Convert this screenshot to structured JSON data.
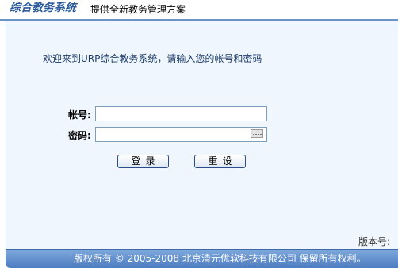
{
  "header": {
    "logo_text": "综合教务系统",
    "tagline": "提供全新教务管理方案"
  },
  "login": {
    "welcome": "欢迎来到URP综合教务系统，请输入您的帐号和密码",
    "account_label": "帐号:",
    "account_value": "",
    "password_label": "密码:",
    "password_value": "",
    "login_button": "登录",
    "reset_button": "重设",
    "keyboard_icon": "virtual-keyboard-icon"
  },
  "version_label": "版本号:",
  "footer": {
    "copyright": "版权所有 © 2005-2008 北京清元优软科技有限公司 保留所有权利。"
  },
  "colors": {
    "header_bar": "#6a94c8",
    "main_bg": "#f0f6fd",
    "footer_bg": "#4d7cc0",
    "logo": "#2a5a9a"
  }
}
